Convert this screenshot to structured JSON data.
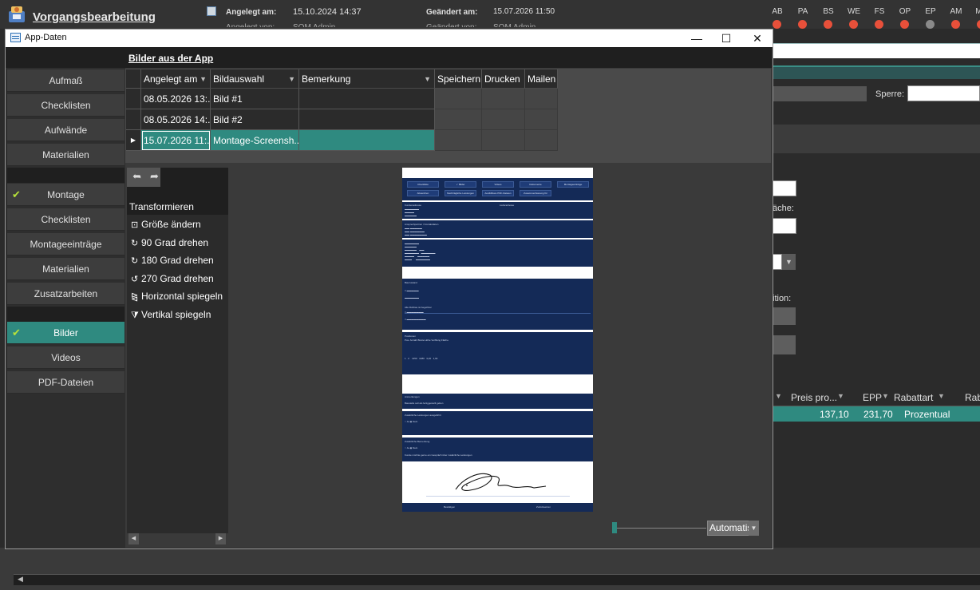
{
  "background_app": {
    "title": "Vorgangsbearbeitung",
    "created_label": "Angelegt am:",
    "created_value": "15.10.2024 14:37",
    "created_by_label": "Angelegt von:",
    "created_by_value": "SOM Admin",
    "changed_label": "Geändert am:",
    "changed_value": "15.07.2026 11:50",
    "changed_by_label": "Geändert von:",
    "changed_by_value": "SOM Admin",
    "status_flags": [
      {
        "label": "AB",
        "color": "#e8503a"
      },
      {
        "label": "PA",
        "color": "#e8503a"
      },
      {
        "label": "BS",
        "color": "#e8503a"
      },
      {
        "label": "WE",
        "color": "#e8503a"
      },
      {
        "label": "FS",
        "color": "#e8503a"
      },
      {
        "label": "OP",
        "color": "#e8503a"
      },
      {
        "label": "EP",
        "color": "#8a8a8a"
      },
      {
        "label": "AM",
        "color": "#e8503a"
      },
      {
        "label": "MC",
        "color": "#e8503a"
      }
    ],
    "sperre_label": "Sperre:",
    "flaeche_label": "äche:",
    "position_label": "ition:",
    "grid_headers": [
      "Preis pro...",
      "EPP",
      "Rabattart",
      "Rab"
    ],
    "grid_row": [
      "137,10",
      "231,70",
      "Prozentual"
    ]
  },
  "window": {
    "title": "App-Daten",
    "header_title": "Bilder aus der App",
    "controls": {
      "minimize": "—",
      "maximize": "☐",
      "close": "✕"
    }
  },
  "sidebar": {
    "group1": [
      "Aufmaß",
      "Checklisten",
      "Aufwände",
      "Materialien"
    ],
    "group2": [
      {
        "label": "Montage",
        "checked": true
      },
      {
        "label": "Checklisten",
        "checked": false
      },
      {
        "label": "Montageeinträge",
        "checked": false
      },
      {
        "label": "Materialien",
        "checked": false
      },
      {
        "label": "Zusatzarbeiten",
        "checked": false
      }
    ],
    "group3": [
      {
        "label": "Bilder",
        "checked": true,
        "active": true
      },
      {
        "label": "Videos",
        "checked": false
      },
      {
        "label": "PDF-Dateien",
        "checked": false
      }
    ],
    "check_glyph": "✔"
  },
  "grid": {
    "headers": [
      "Angelegt am",
      "Bildauswahl",
      "Bemerkung",
      "Speichern",
      "Drucken",
      "Mailen"
    ],
    "rows": [
      {
        "date": "08.05.2026 13:...",
        "name": "Bild #1",
        "note": ""
      },
      {
        "date": "08.05.2026 14:...",
        "name": "Bild #2",
        "note": ""
      },
      {
        "date": "15.07.2026 11:...",
        "name": "Montage-Screensh...",
        "note": "",
        "selected": true
      }
    ],
    "selected_marker": "▶",
    "filter_glyph": "▼"
  },
  "transform": {
    "heading": "Transformieren",
    "items": [
      {
        "icon": "⊡",
        "label": "Größe ändern"
      },
      {
        "icon": "↻",
        "label": "90 Grad drehen"
      },
      {
        "icon": "↻",
        "label": "180 Grad drehen"
      },
      {
        "icon": "↺",
        "label": "270 Grad drehen"
      },
      {
        "icon": "⧎",
        "label": "Horizontal spiegeln"
      },
      {
        "icon": "⧩",
        "label": "Vertikal spiegeln"
      }
    ],
    "undo": "➦",
    "redo": "➦"
  },
  "viewer": {
    "zoom_mode": "Automatisch",
    "zoom_level": 0.0,
    "phone": {
      "tabs_row1": [
        "Checkliste",
        "✓ Bilder",
        "Videos",
        "Dokumente",
        "Montageeinträge"
      ],
      "tabs_row2": [
        "Abweichen",
        "Nachträgliche Leistungen",
        "Ausfüllbare PDF-Dateien",
        "Zusammenfassung für diesen Vorgang"
      ],
      "sec1": [
        "Kundenadresse",
        "Lieferadresse"
      ],
      "sec2": "Ansprechpartner / Kontaktdaten",
      "sec4_title": "Bauzustand",
      "sec4_line": "Alle Rohbau ist begehbar",
      "sec5_title": "Positionen",
      "sec5_cols": "Pos.  Anzahl   Breite   Höhe   Verfllung   Fläche",
      "sec6_title": "Anmerkungen",
      "sec6_text": "Baustelle soll als fertiggestellt gelten",
      "sec7_title": "Zusätzliche Leistungen ausgeführt",
      "sec8_title": "Zusätzliche Bemerkung",
      "sec8_text": "Kunde möchte gerne ein Gespräch über zusätzliche Leistungen",
      "footer_left": "Bestätigen",
      "footer_right": "Zurücksetzen"
    }
  }
}
